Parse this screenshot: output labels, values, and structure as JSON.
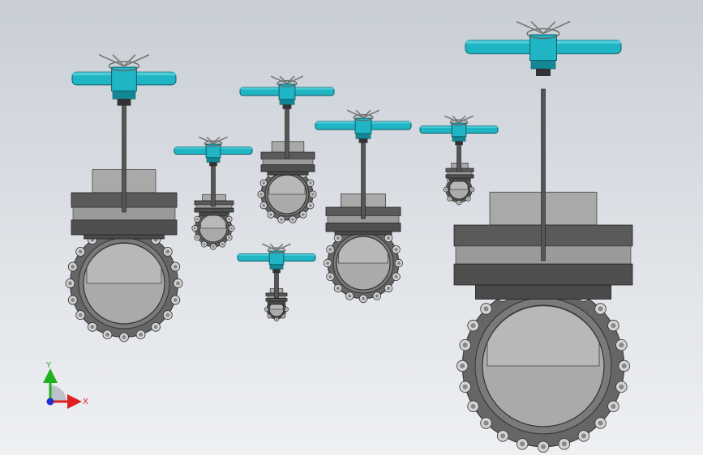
{
  "viewport": {
    "colors": {
      "actuator": "#1fb5c4",
      "actuator_dark": "#128896",
      "body_dark": "#4a4a4a",
      "body_mid": "#666666",
      "gate_light": "#a9a9a9",
      "bolt": "#d4d4d4",
      "stem": "#555555"
    },
    "triad": {
      "x_label": "X",
      "y_label": "Y",
      "x_color": "#e02020",
      "y_color": "#20b020",
      "z_color": "#2030d0"
    },
    "valves": [
      {
        "name": "valve-large-left",
        "size_class": "large",
        "bolts": 20
      },
      {
        "name": "valve-small-a",
        "size_class": "small",
        "bolts": 12
      },
      {
        "name": "valve-medium-a",
        "size_class": "medium",
        "bolts": 14
      },
      {
        "name": "valve-tiny-a",
        "size_class": "tiny",
        "bolts": 8
      },
      {
        "name": "valve-medium-b",
        "size_class": "medium",
        "bolts": 16
      },
      {
        "name": "valve-tiny-b",
        "size_class": "tiny",
        "bolts": 8
      },
      {
        "name": "valve-huge-right",
        "size_class": "huge",
        "bolts": 24
      }
    ]
  }
}
